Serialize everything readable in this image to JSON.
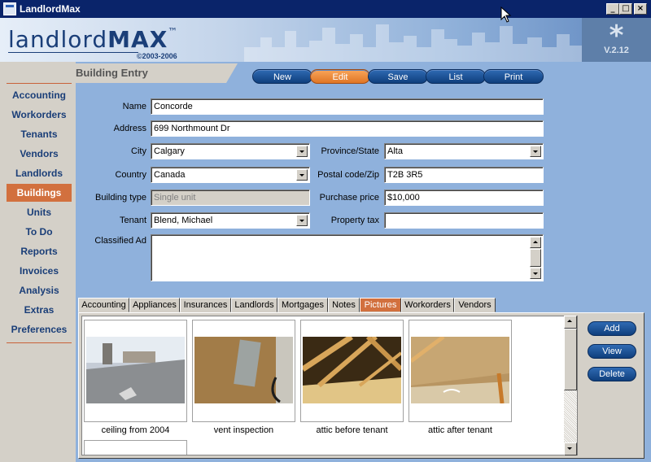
{
  "window": {
    "title": "LandlordMax"
  },
  "header": {
    "logo_light": "landlord",
    "logo_bold": "MAX",
    "logo_tm": "™",
    "copyright": "©2003-2006",
    "version": "V.2.12",
    "asterisk": "*"
  },
  "sidebar": {
    "items": [
      {
        "label": "Accounting"
      },
      {
        "label": "Workorders"
      },
      {
        "label": "Tenants"
      },
      {
        "label": "Vendors"
      },
      {
        "label": "Landlords"
      },
      {
        "label": "Buildings"
      },
      {
        "label": "Units"
      },
      {
        "label": "To Do"
      },
      {
        "label": "Reports"
      },
      {
        "label": "Invoices"
      },
      {
        "label": "Analysis"
      },
      {
        "label": "Extras"
      },
      {
        "label": "Preferences"
      }
    ],
    "active": "Buildings"
  },
  "section": {
    "title": "Building Entry"
  },
  "toolbar": {
    "new": "New",
    "edit": "Edit",
    "save": "Save",
    "list": "List",
    "print": "Print"
  },
  "form": {
    "name_label": "Name",
    "name_value": "Concorde",
    "address_label": "Address",
    "address_value": "699 Northmount Dr",
    "city_label": "City",
    "city_value": "Calgary",
    "province_label": "Province/State",
    "province_value": "Alta",
    "country_label": "Country",
    "country_value": "Canada",
    "postal_label": "Postal code/Zip",
    "postal_value": "T2B 3R5",
    "building_type_label": "Building type",
    "building_type_value": "Single unit",
    "purchase_price_label": "Purchase price",
    "purchase_price_value": "$10,000",
    "tenant_label": "Tenant",
    "tenant_value": "Blend, Michael",
    "property_tax_label": "Property tax",
    "property_tax_value": "",
    "classified_label": "Classified Ad",
    "classified_value": ""
  },
  "tabs": [
    {
      "label": "Accounting"
    },
    {
      "label": "Appliances"
    },
    {
      "label": "Insurances"
    },
    {
      "label": "Landlords"
    },
    {
      "label": "Mortgages"
    },
    {
      "label": "Notes"
    },
    {
      "label": "Pictures"
    },
    {
      "label": "Workorders"
    },
    {
      "label": "Vendors"
    }
  ],
  "active_tab": "Pictures",
  "pictures": [
    {
      "caption": "ceiling from 2004"
    },
    {
      "caption": "vent inspection"
    },
    {
      "caption": "attic before tenant"
    },
    {
      "caption": "attic after tenant"
    }
  ],
  "picture_actions": {
    "add": "Add",
    "view": "View",
    "delete": "Delete"
  },
  "colors": {
    "accent_orange": "#d2703e",
    "navy": "#0a246a",
    "panel_blue": "#8fb1dc"
  }
}
